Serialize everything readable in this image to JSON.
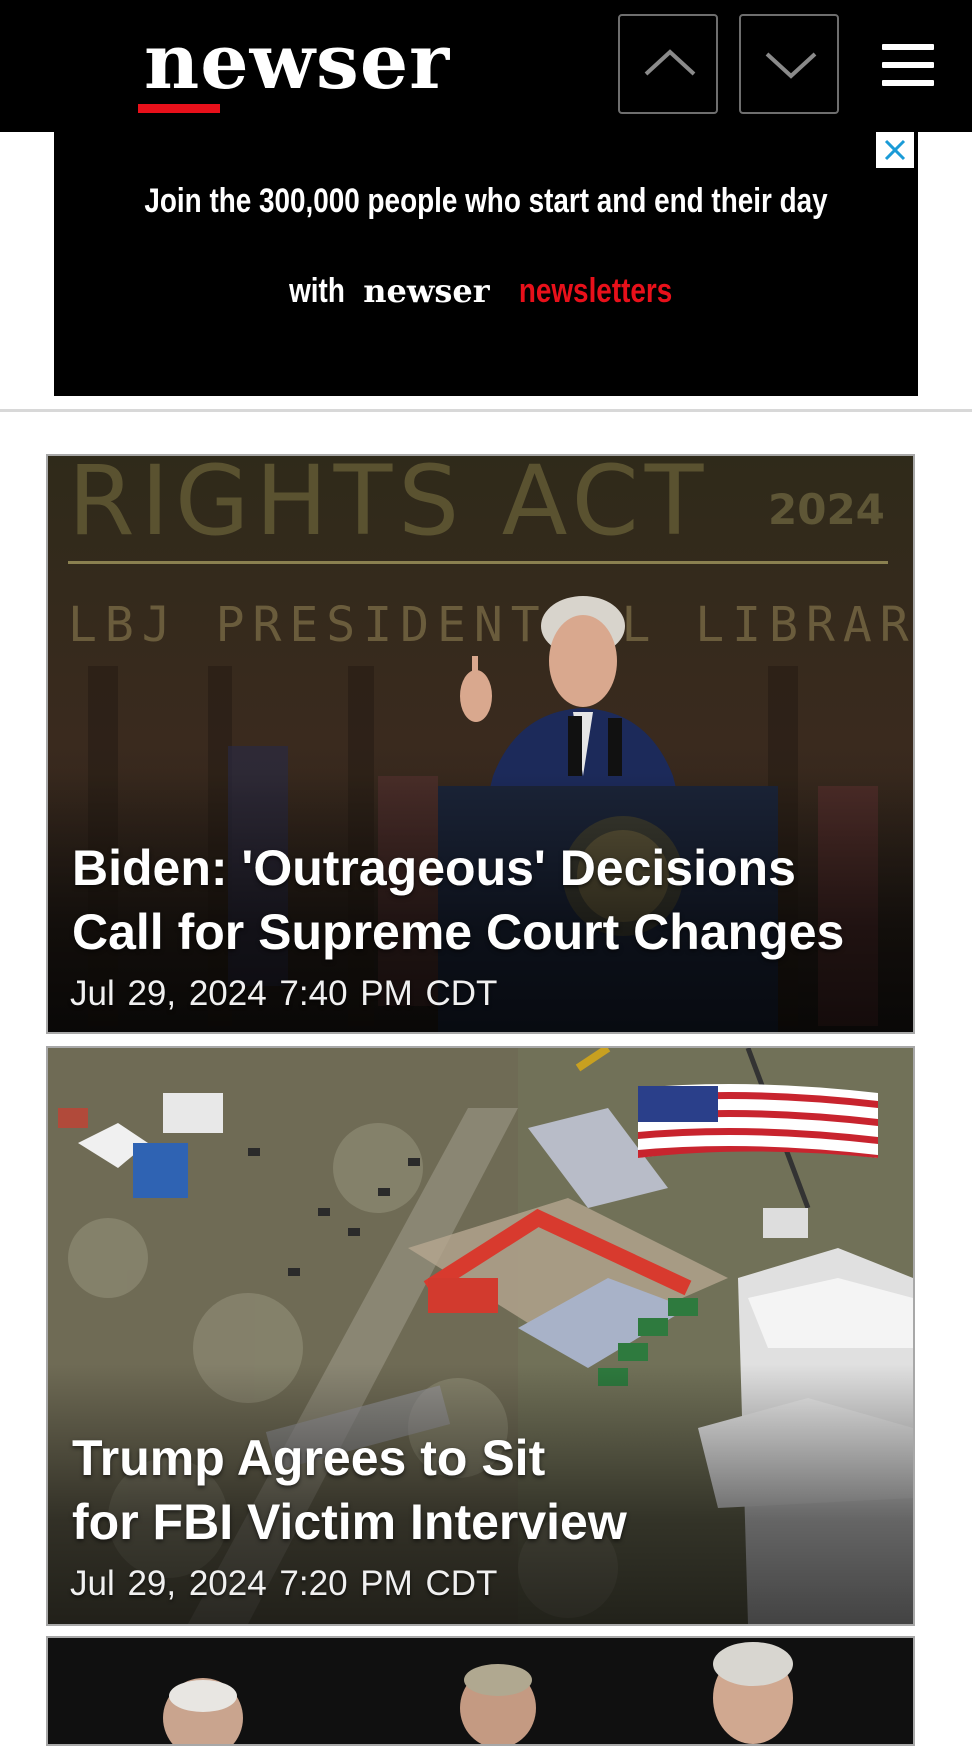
{
  "header": {
    "logo": "newser",
    "colors": {
      "background": "#000000",
      "accent": "#e8101a"
    },
    "icons": [
      "chevron-up-icon",
      "chevron-down-icon",
      "hamburger-menu-icon"
    ]
  },
  "ad": {
    "line1": "Join the 300,000 people who start and end their day",
    "line2_prefix": "with",
    "brand": "newser",
    "highlight": "newsletters",
    "close_icon": "close-icon"
  },
  "stories": [
    {
      "title": "Biden: 'Outrageous' Decisions\nCall for Supreme Court Changes",
      "date": "Jul 29, 2024  7:40 PM CDT",
      "image_text": {
        "banner_top": "RIGHTS ACT",
        "year": "2024",
        "banner_bottom": "LBJ PRESIDENTIAL LIBRARY"
      }
    },
    {
      "title": "Trump Agrees to Sit\nfor FBI Victim Interview",
      "date": "Jul 29, 2024  7:20 PM CDT"
    },
    {
      "title": "",
      "date": ""
    }
  ]
}
